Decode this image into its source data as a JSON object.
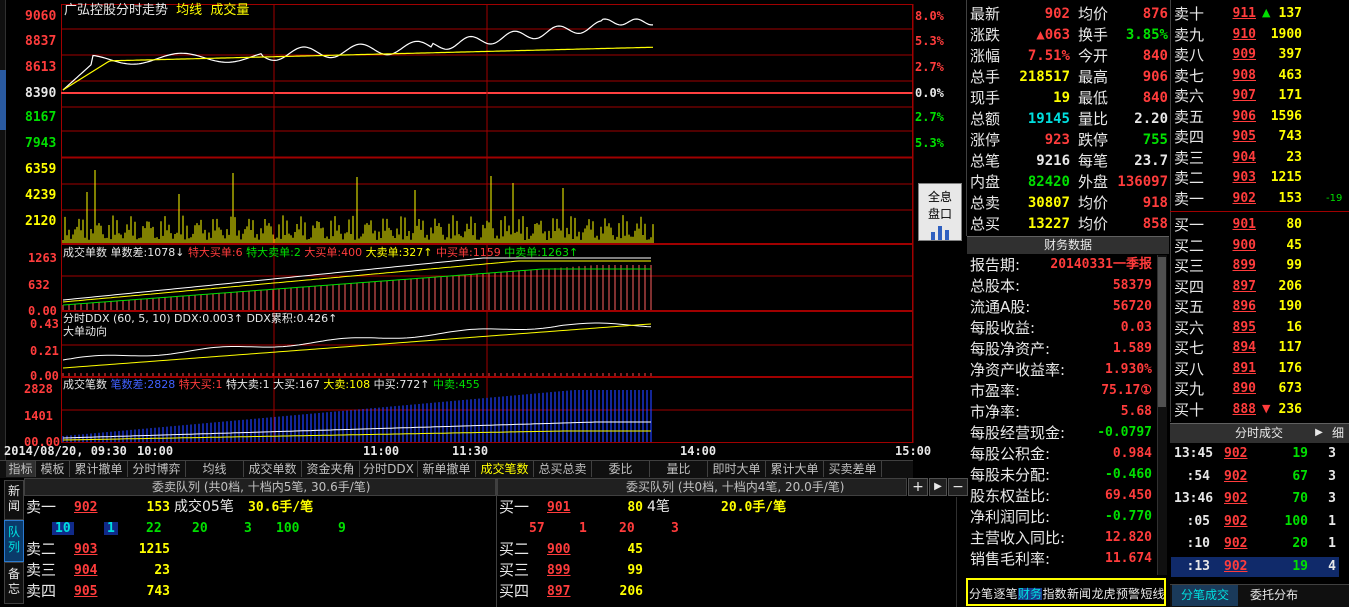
{
  "chart_title": {
    "name": "广弘控股分时走势",
    "avg": "均线",
    "vol": "成交量"
  },
  "price_ticks": [
    "9060",
    "8837",
    "8613",
    "8390",
    "8167",
    "7943"
  ],
  "pct_ticks": [
    "8.0%",
    "5.3%",
    "2.7%",
    "0.0%",
    "2.7%",
    "5.3%"
  ],
  "vol_ticks": [
    "6359",
    "4239",
    "2120"
  ],
  "time_labels": [
    "2014/08/20, 09:30",
    "10:00",
    "11:00",
    "11:30",
    "14:00",
    "15:00"
  ],
  "quanxi_button": [
    "全息",
    "盘口"
  ],
  "ind1": {
    "title": "成交单数",
    "diff_label": "单数差:",
    "diff": "1078↓",
    "tdmr_label": "特大买单:",
    "tdmr": "6",
    "tdmc_label": "特大卖单:",
    "tdmc": "2",
    "dmr_label": "大买单:",
    "dmr": "400",
    "dmc_label": "大卖单:",
    "dmc": "327↑",
    "zmc_label": "中买单:",
    "zmc": "1159",
    "zmr_label": "中卖单:",
    "zmr": "1263↑",
    "ticks": [
      "1263",
      "632",
      "0.00"
    ]
  },
  "ind2": {
    "title": "分时DDX (60, 5, 10)",
    "ddx_label": "DDX:",
    "ddx": "0.003↑",
    "ddx_sum_label": "DDX累积:",
    "ddx_sum": "0.426↑",
    "sub": "大单动向",
    "ticks": [
      "0.43",
      "0.21",
      "0.00"
    ]
  },
  "ind3": {
    "title": "成交笔数",
    "diff_label": "笔数差:",
    "diff": "2828",
    "tdm_label": "特大买:",
    "tdm": "1",
    "tdmc_label": "特大卖:",
    "tdmc": "1",
    "dm_label": "大买:",
    "dm": "167",
    "dmc_label": "大卖:",
    "dmc": "108",
    "zm_label": "中买:",
    "zm": "772↑",
    "zmc_label": "中卖:",
    "zmc": "455",
    "ticks": [
      "2828",
      "1401",
      "00.00"
    ]
  },
  "left_sidebar": [
    "新闻",
    "队列",
    "备忘"
  ],
  "tabs": [
    "指标",
    "模板",
    "累计撤单",
    "分时博弈",
    "均线",
    "成交单数",
    "资金夹角",
    "分时DDX",
    "新单撤单",
    "成交笔数",
    "总买总卖",
    "委比",
    "量比",
    "即时大单",
    "累计大单",
    "买卖差单"
  ],
  "quote": [
    {
      "l1": "最新",
      "v1": "902",
      "l2": "均价",
      "v2": "876"
    },
    {
      "l1": "涨跌",
      "v1": "▲063",
      "l2": "换手",
      "v2": "3.85%"
    },
    {
      "l1": "涨幅",
      "v1": "7.51%",
      "l2": "今开",
      "v2": "840"
    },
    {
      "l1": "总手",
      "v1": "218517",
      "l2": "最高",
      "v2": "906"
    },
    {
      "l1": "现手",
      "v1": "19",
      "l2": "最低",
      "v2": "840"
    },
    {
      "l1": "总额",
      "v1": "19145",
      "l2": "量比",
      "v2": "2.20"
    },
    {
      "l1": "涨停",
      "v1": "923",
      "l2": "跌停",
      "v2": "755"
    },
    {
      "l1": "总笔",
      "v1": "9216",
      "l2": "每笔",
      "v2": "23.7"
    },
    {
      "l1": "内盘",
      "v1": "82420",
      "l2": "外盘",
      "v2": "136097"
    },
    {
      "l1": "总卖",
      "v1": "30807",
      "l2": "均价",
      "v2": "918"
    },
    {
      "l1": "总买",
      "v1": "13227",
      "l2": "均价",
      "v2": "858"
    }
  ],
  "finance": {
    "title": "财务数据",
    "rows": [
      {
        "k": "报告期:",
        "v": "20140331一季报"
      },
      {
        "k": "总股本:",
        "v": "58379"
      },
      {
        "k": "流通A股:",
        "v": "56720"
      },
      {
        "k": "每股收益:",
        "v": "0.03"
      },
      {
        "k": "每股净资产:",
        "v": "1.589"
      },
      {
        "k": "净资产收益率:",
        "v": "1.930%"
      },
      {
        "k": "市盈率:",
        "v": "75.17①"
      },
      {
        "k": "市净率:",
        "v": "5.68"
      },
      {
        "k": "每股经营现金:",
        "v": "-0.0797"
      },
      {
        "k": "每股公积金:",
        "v": "0.984"
      },
      {
        "k": "每股未分配:",
        "v": "-0.460"
      },
      {
        "k": "股东权益比:",
        "v": "69.450"
      },
      {
        "k": "净利润同比:",
        "v": "-0.770"
      },
      {
        "k": "主营收入同比:",
        "v": "12.820"
      },
      {
        "k": "销售毛利率:",
        "v": "11.674"
      }
    ]
  },
  "bottom_tabs_mid": [
    "分笔",
    "逐笔",
    "财务",
    "指数",
    "新闻",
    "龙虎",
    "预警",
    "短线"
  ],
  "order_book": {
    "sells": [
      {
        "l": "卖十",
        "p": "911",
        "flag": "▲",
        "v": "137"
      },
      {
        "l": "卖九",
        "p": "910",
        "v": "1900"
      },
      {
        "l": "卖八",
        "p": "909",
        "v": "397"
      },
      {
        "l": "卖七",
        "p": "908",
        "v": "463"
      },
      {
        "l": "卖六",
        "p": "907",
        "v": "171"
      },
      {
        "l": "卖五",
        "p": "906",
        "v": "1596"
      },
      {
        "l": "卖四",
        "p": "905",
        "v": "743"
      },
      {
        "l": "卖三",
        "p": "904",
        "v": "23"
      },
      {
        "l": "卖二",
        "p": "903",
        "v": "1215"
      },
      {
        "l": "卖一",
        "p": "902",
        "v": "153",
        "extra": "-19"
      }
    ],
    "buys": [
      {
        "l": "买一",
        "p": "901",
        "v": "80"
      },
      {
        "l": "买二",
        "p": "900",
        "v": "45"
      },
      {
        "l": "买三",
        "p": "899",
        "v": "99"
      },
      {
        "l": "买四",
        "p": "897",
        "v": "206"
      },
      {
        "l": "买五",
        "p": "896",
        "v": "190"
      },
      {
        "l": "买六",
        "p": "895",
        "v": "16"
      },
      {
        "l": "买七",
        "p": "894",
        "v": "117"
      },
      {
        "l": "买八",
        "p": "891",
        "v": "176"
      },
      {
        "l": "买九",
        "p": "890",
        "v": "673"
      },
      {
        "l": "买十",
        "p": "888",
        "flag": "▼",
        "v": "236"
      }
    ]
  },
  "trades": {
    "title": "分时成交",
    "detail": "细",
    "rows": [
      {
        "t": "13:45",
        "p": "902",
        "v": "19",
        "n": "3"
      },
      {
        "t": ":54",
        "p": "902",
        "v": "67",
        "n": "3"
      },
      {
        "t": "13:46",
        "p": "902",
        "v": "70",
        "n": "3"
      },
      {
        "t": ":05",
        "p": "902",
        "v": "100",
        "n": "1"
      },
      {
        "t": ":10",
        "p": "902",
        "v": "20",
        "n": "1"
      },
      {
        "t": ":13",
        "p": "902",
        "v": "19",
        "n": "4"
      }
    ]
  },
  "right_bottom_tabs": [
    "分笔成交",
    "委托分布"
  ],
  "queue_sell": {
    "header": "委卖队列 (共0档, 十档内5笔, 30.6手/笔)",
    "rows": [
      {
        "l": "卖一",
        "p": "902",
        "v": "153",
        "x": "成交05笔",
        "y": "30.6手/笔"
      },
      {
        "q": [
          "10",
          "1",
          "22",
          "20",
          "3",
          "100",
          "9"
        ]
      },
      {
        "l": "卖二",
        "p": "903",
        "v": "1215"
      },
      {
        "l": "卖三",
        "p": "904",
        "v": "23"
      },
      {
        "l": "卖四",
        "p": "905",
        "v": "743"
      }
    ]
  },
  "queue_buy": {
    "header": "委买队列 (共0档, 十档内4笔, 20.0手/笔)",
    "rows": [
      {
        "l": "买一",
        "p": "901",
        "v": "80",
        "x": "4笔",
        "y": "20.0手/笔"
      },
      {
        "q": [
          "57",
          "1",
          "20",
          "3"
        ]
      },
      {
        "l": "买二",
        "p": "900",
        "v": "45"
      },
      {
        "l": "买三",
        "p": "899",
        "v": "99"
      },
      {
        "l": "买四",
        "p": "897",
        "v": "206"
      }
    ]
  },
  "colors": {
    "up": "#ff3c3c",
    "down": "#00e000",
    "grid": "#a00000",
    "highlight": "#ffff00"
  }
}
